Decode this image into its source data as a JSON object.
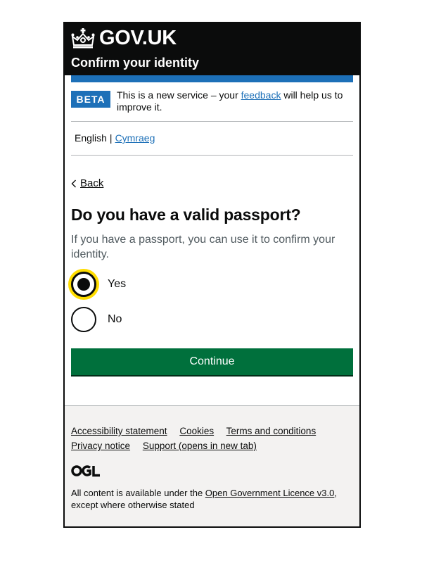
{
  "header": {
    "logo_text": "GOV.UK",
    "service_name": "Confirm your identity",
    "logo_icon": "crown-icon"
  },
  "phase_banner": {
    "tag": "BETA",
    "text_before": "This is a new service – your ",
    "link": "feedback",
    "text_after": " will help us to improve it."
  },
  "language": {
    "current": "English",
    "separator": "|",
    "alternate": "Cymraeg"
  },
  "back_link": {
    "label": "Back",
    "icon": "chevron-left-icon"
  },
  "question": {
    "title": "Do you have a valid passport?",
    "hint": "If you have a passport, you can use it to confirm your identity.",
    "options": [
      {
        "label": "Yes",
        "selected": true
      },
      {
        "label": "No",
        "selected": false
      }
    ]
  },
  "continue_button": {
    "label": "Continue"
  },
  "footer": {
    "links": [
      "Accessibility statement",
      "Cookies",
      "Terms and conditions",
      "Privacy notice",
      "Support (opens in new tab)"
    ],
    "logo_icon": "ogl-logo-icon",
    "logo_text": "OGL",
    "licence_before": "All content is available under the ",
    "licence_link": "Open Government Licence v3.0",
    "licence_after": ", except where otherwise stated"
  },
  "colors": {
    "header_bg": "#0b0c0c",
    "brand_blue": "#1d70b8",
    "button_green": "#00703c",
    "focus_yellow": "#ffdd00",
    "footer_bg": "#f3f2f1"
  }
}
